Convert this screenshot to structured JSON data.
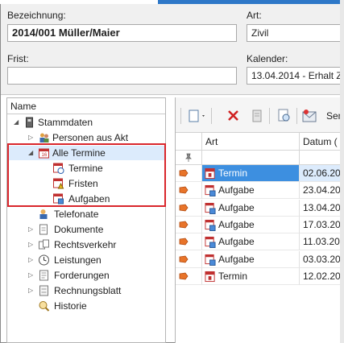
{
  "form": {
    "bezeichnung_label": "Bezeichnung:",
    "bezeichnung_value": "2014/001 Müller/Maier",
    "art_label": "Art:",
    "art_value": "Zivil",
    "frist_label": "Frist:",
    "frist_value": "",
    "kalender_label": "Kalender:",
    "kalender_value": "13.04.2014 - Erhalt Z"
  },
  "tree": {
    "header": "Name",
    "items": [
      {
        "label": "Stammdaten",
        "icon": "phone-cabinet-icon",
        "arrow": "expanded"
      },
      {
        "label": "Personen aus Akt",
        "icon": "persons-icon",
        "arrow": "collapsed"
      },
      {
        "label": "Alle Termine",
        "icon": "calendar-icon",
        "arrow": "expanded"
      },
      {
        "label": "Termine",
        "icon": "appointment-icon",
        "arrow": ""
      },
      {
        "label": "Fristen",
        "icon": "deadline-icon",
        "arrow": ""
      },
      {
        "label": "Aufgaben",
        "icon": "task-icon",
        "arrow": ""
      },
      {
        "label": "Telefonate",
        "icon": "telephone-icon",
        "arrow": ""
      },
      {
        "label": "Dokumente",
        "icon": "documents-icon",
        "arrow": "collapsed"
      },
      {
        "label": "Rechtsverkehr",
        "icon": "legal-exchange-icon",
        "arrow": "collapsed"
      },
      {
        "label": "Leistungen",
        "icon": "clock-icon",
        "arrow": "collapsed"
      },
      {
        "label": "Forderungen",
        "icon": "claims-icon",
        "arrow": "collapsed"
      },
      {
        "label": "Rechnungsblatt",
        "icon": "invoice-icon",
        "arrow": "collapsed"
      },
      {
        "label": "Historie",
        "icon": "history-icon",
        "arrow": ""
      }
    ]
  },
  "toolbar": {
    "new_icon": "new-document-icon",
    "delete_icon": "delete-icon",
    "print_icon": "print-icon",
    "preview_icon": "preview-icon",
    "send_label": "Sen"
  },
  "grid": {
    "columns": [
      "Art",
      "Datum ("
    ],
    "rows": [
      {
        "art": "Termin",
        "datum": "02.06.20",
        "type": "termin",
        "selected": true
      },
      {
        "art": "Aufgabe",
        "datum": "23.04.20",
        "type": "aufgabe",
        "selected": false
      },
      {
        "art": "Aufgabe",
        "datum": "13.04.20",
        "type": "aufgabe",
        "selected": false
      },
      {
        "art": "Aufgabe",
        "datum": "17.03.20",
        "type": "aufgabe",
        "selected": false
      },
      {
        "art": "Aufgabe",
        "datum": "11.03.20",
        "type": "aufgabe",
        "selected": false
      },
      {
        "art": "Aufgabe",
        "datum": "03.03.20",
        "type": "aufgabe",
        "selected": false
      },
      {
        "art": "Termin",
        "datum": "12.02.20",
        "type": "termin",
        "selected": false
      }
    ]
  },
  "colors": {
    "highlight_border": "#d9262c",
    "selection": "#3d8fe0",
    "tree_selection": "#dcebfc"
  }
}
